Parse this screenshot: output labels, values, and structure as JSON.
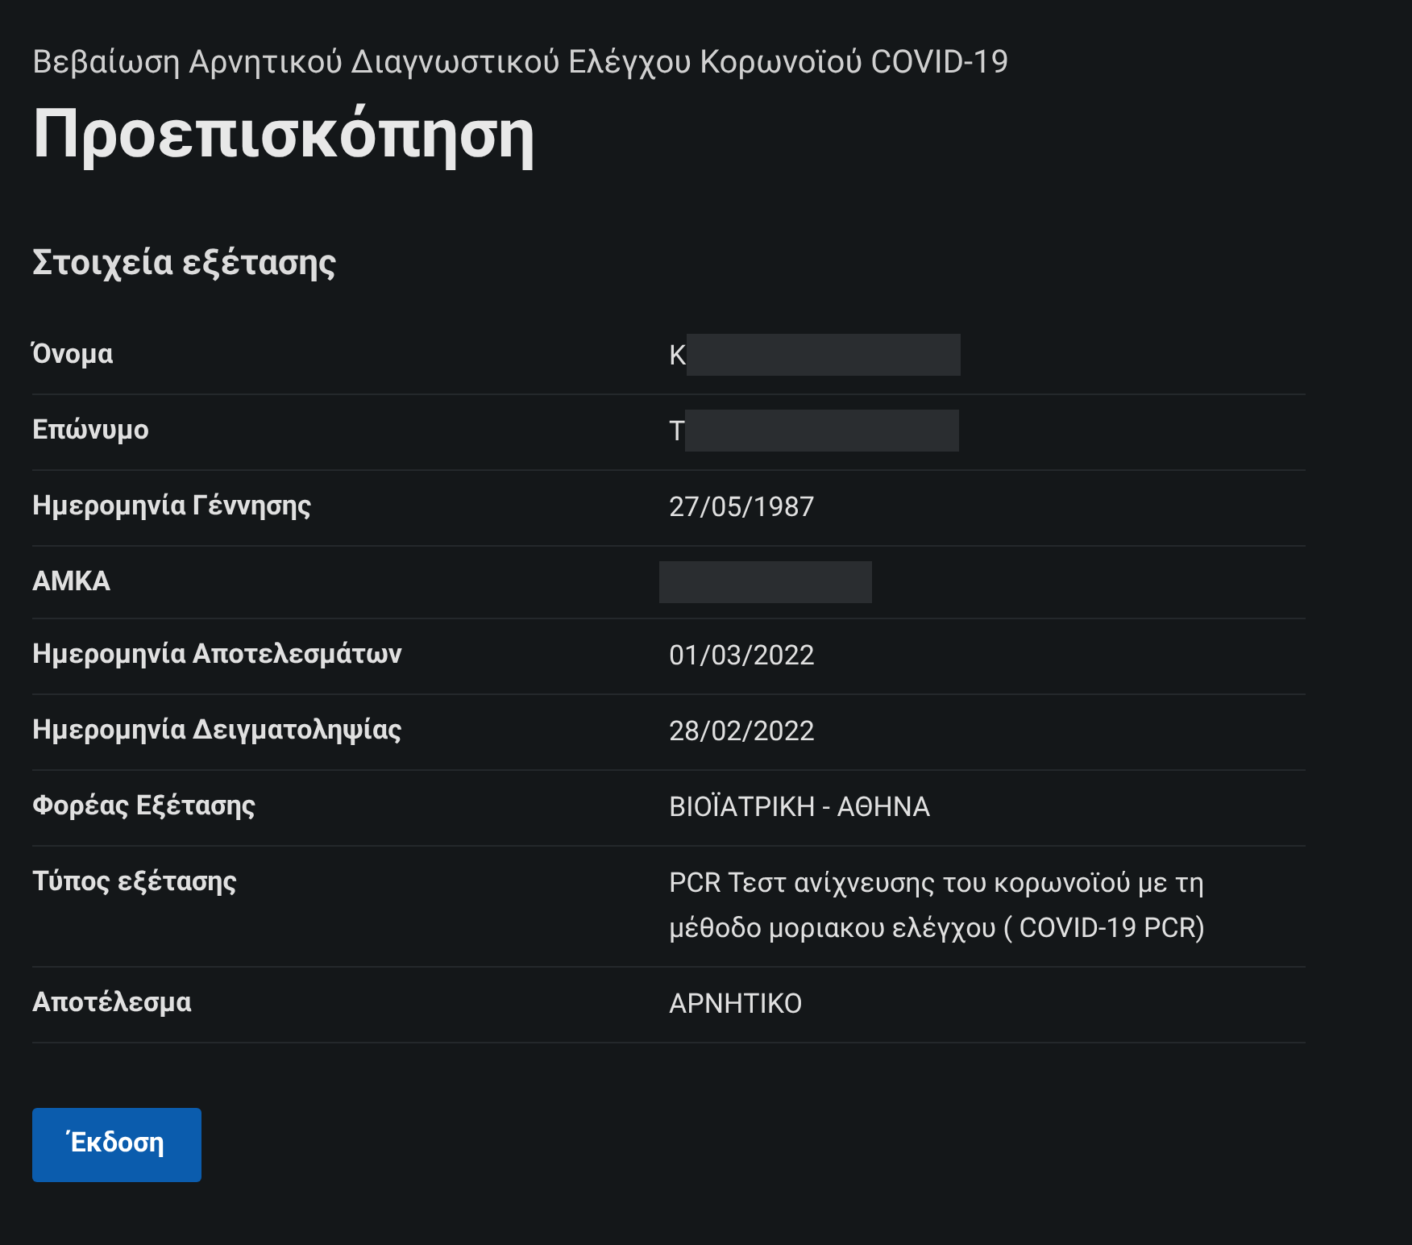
{
  "header": {
    "subtitle": "Βεβαίωση Αρνητικού Διαγνωστικού Ελέγχου Κορωνοϊού COVID-19",
    "title": "Προεπισκόπηση"
  },
  "section": {
    "title": "Στοιχεία εξέτασης"
  },
  "rows": [
    {
      "label": "Όνομα",
      "value": "Κ",
      "redacted": true
    },
    {
      "label": "Επώνυμο",
      "value": "Τ",
      "redacted": true
    },
    {
      "label": "Ημερομηνία Γέννησης",
      "value": "27/05/1987",
      "redacted": false
    },
    {
      "label": "ΑΜΚΑ",
      "redacted": true
    },
    {
      "label": "Ημερομηνία Αποτελεσμάτων",
      "value": "01/03/2022",
      "redacted": false
    },
    {
      "label": "Ημερομηνία Δειγματοληψίας",
      "value": "28/02/2022",
      "redacted": false
    },
    {
      "label": "Φορέας Εξέτασης",
      "value": "ΒΙΟΪΑΤΡΙΚΗ - ΑΘΗΝΑ",
      "redacted": false
    },
    {
      "label": "Τύπος εξέτασης",
      "value": "PCR Τεστ ανίχνευσης του κορωνοϊού με τη μέθοδο μοριακου ελέγχου ( COVID-19 PCR)",
      "redacted": false
    },
    {
      "label": "Αποτέλεσμα",
      "value": "ΑΡΝΗΤΙΚΟ",
      "redacted": false
    }
  ],
  "button": {
    "label": "Έκδοση"
  }
}
